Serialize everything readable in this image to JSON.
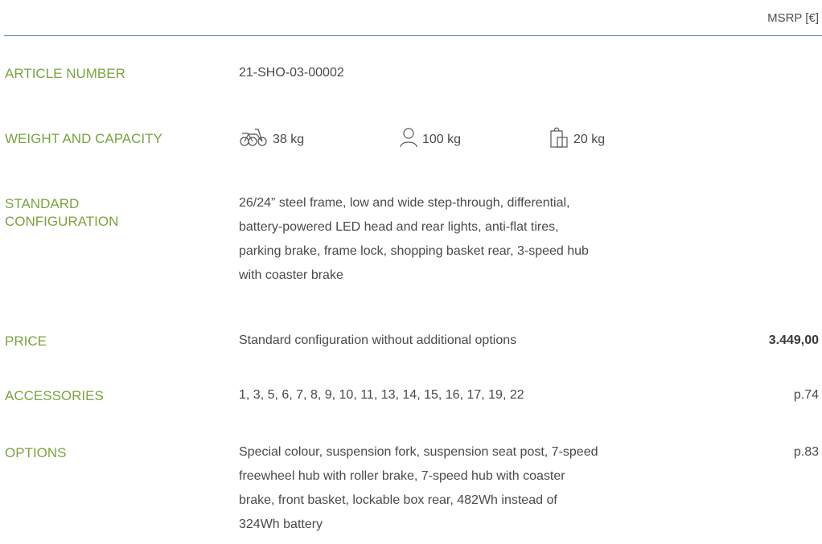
{
  "header": {
    "msrp": "MSRP [€]"
  },
  "article": {
    "label": "ARTICLE NUMBER",
    "value": "21-SHO-03-00002"
  },
  "weight": {
    "label": "WEIGHT AND CAPACITY",
    "bike": {
      "icon": "tricycle-icon",
      "value": "38 kg"
    },
    "rider": {
      "icon": "person-icon",
      "value": "100 kg"
    },
    "luggage": {
      "icon": "bag-icon",
      "value": "20 kg"
    }
  },
  "standard": {
    "label_line1": "STANDARD",
    "label_line2": "CONFIGURATION",
    "lines": [
      "26/24” steel frame, low and wide step-through, differential,",
      "battery-powered LED head and rear lights, anti-flat tires,",
      "parking brake, frame lock, shopping basket rear, 3-speed hub",
      "with coaster brake"
    ]
  },
  "price": {
    "label": "PRICE",
    "description": "Standard configuration without additional options",
    "amount": "3.449,00"
  },
  "accessories": {
    "label": "ACCESSORIES",
    "value": "1, 3, 5, 6, 7, 8, 9, 10, 11, 13, 14, 15, 16, 17, 19, 22",
    "page": "p.74"
  },
  "options": {
    "label": "OPTIONS",
    "lines": [
      "Special colour, suspension fork, suspension seat post, 7-speed",
      "freewheel hub with roller brake, 7-speed hub with coaster",
      "brake, front basket, lockable box rear, 482Wh instead of",
      "324Wh battery"
    ],
    "page": "p.83"
  },
  "colors": {
    "label": "#7aa341",
    "rule": "#5a7ca0",
    "text": "#4a4a4a"
  }
}
